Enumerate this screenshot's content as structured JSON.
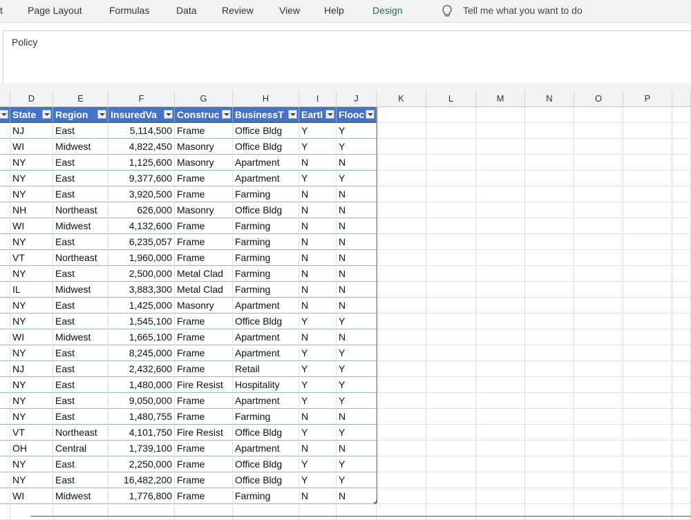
{
  "ribbon": {
    "partial_tab": "t",
    "tabs": [
      {
        "label": "Page Layout"
      },
      {
        "label": "Formulas"
      },
      {
        "label": "Data"
      },
      {
        "label": "Review"
      },
      {
        "label": "View"
      },
      {
        "label": "Help"
      },
      {
        "label": "Design",
        "active": true
      }
    ],
    "tell_me": "Tell me what you want to do"
  },
  "formula_bar": {
    "text": "Policy"
  },
  "columns": [
    "D",
    "E",
    "F",
    "G",
    "H",
    "I",
    "J",
    "K",
    "L",
    "M",
    "N",
    "O",
    "P"
  ],
  "table": {
    "headers": [
      "State",
      "Region",
      "InsuredVa",
      "Construc",
      "BusinessT",
      "Eartl",
      "Flooc"
    ],
    "rows": [
      [
        "NJ",
        "East",
        "5,114,500",
        "Frame",
        "Office Bldg",
        "Y",
        "Y"
      ],
      [
        "WI",
        "Midwest",
        "4,822,450",
        "Masonry",
        "Office Bldg",
        "Y",
        "Y"
      ],
      [
        "NY",
        "East",
        "1,125,600",
        "Masonry",
        "Apartment",
        "N",
        "N"
      ],
      [
        "NY",
        "East",
        "9,377,600",
        "Frame",
        "Apartment",
        "Y",
        "Y"
      ],
      [
        "NY",
        "East",
        "3,920,500",
        "Frame",
        "Farming",
        "N",
        "N"
      ],
      [
        "NH",
        "Northeast",
        "626,000",
        "Masonry",
        "Office Bldg",
        "N",
        "N"
      ],
      [
        "WI",
        "Midwest",
        "4,132,600",
        "Frame",
        "Farming",
        "N",
        "N"
      ],
      [
        "NY",
        "East",
        "6,235,057",
        "Frame",
        "Farming",
        "N",
        "N"
      ],
      [
        "VT",
        "Northeast",
        "1,960,000",
        "Frame",
        "Farming",
        "N",
        "N"
      ],
      [
        "NY",
        "East",
        "2,500,000",
        "Metal Clad",
        "Farming",
        "N",
        "N"
      ],
      [
        "IL",
        "Midwest",
        "3,883,300",
        "Metal Clad",
        "Farming",
        "N",
        "N"
      ],
      [
        "NY",
        "East",
        "1,425,000",
        "Masonry",
        "Apartment",
        "N",
        "N"
      ],
      [
        "NY",
        "East",
        "1,545,100",
        "Frame",
        "Office Bldg",
        "Y",
        "Y"
      ],
      [
        "WI",
        "Midwest",
        "1,665,100",
        "Frame",
        "Apartment",
        "N",
        "N"
      ],
      [
        "NY",
        "East",
        "8,245,000",
        "Frame",
        "Apartment",
        "Y",
        "Y"
      ],
      [
        "NJ",
        "East",
        "2,432,600",
        "Frame",
        "Retail",
        "Y",
        "Y"
      ],
      [
        "NY",
        "East",
        "1,480,000",
        "Fire Resist",
        "Hospitality",
        "Y",
        "Y"
      ],
      [
        "NY",
        "East",
        "9,050,000",
        "Frame",
        "Apartment",
        "Y",
        "Y"
      ],
      [
        "NY",
        "East",
        "1,480,755",
        "Frame",
        "Farming",
        "N",
        "N"
      ],
      [
        "VT",
        "Northeast",
        "4,101,750",
        "Fire Resist",
        "Office Bldg",
        "Y",
        "Y"
      ],
      [
        "OH",
        "Central",
        "1,739,100",
        "Frame",
        "Apartment",
        "N",
        "N"
      ],
      [
        "NY",
        "East",
        "2,250,000",
        "Frame",
        "Office Bldg",
        "Y",
        "Y"
      ],
      [
        "NY",
        "East",
        "16,482,200",
        "Frame",
        "Office Bldg",
        "Y",
        "Y"
      ],
      [
        "WI",
        "Midwest",
        "1,776,800",
        "Frame",
        "Farming",
        "N",
        "N"
      ]
    ]
  },
  "colors": {
    "table_header": "#4472c4",
    "design_tab": "#217346"
  }
}
